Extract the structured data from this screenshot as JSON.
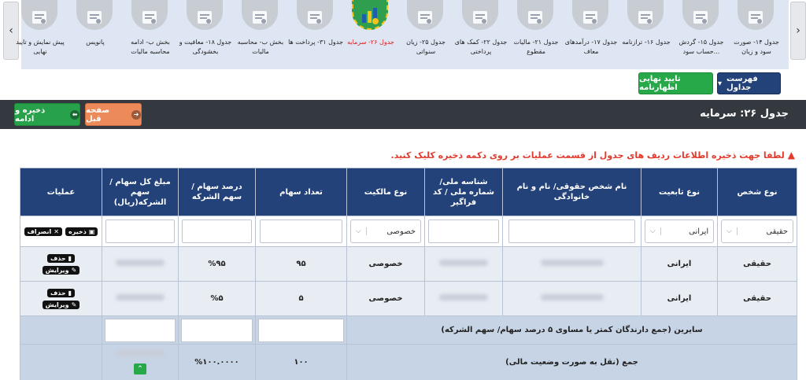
{
  "nav": {
    "items": [
      {
        "label": "جدول ۱۴- صورت سود و زیان",
        "icon": "scales-icon",
        "active": false
      },
      {
        "label": "جدول ۱۵- گردش حساب سود...",
        "icon": "coins-gear-icon",
        "active": false
      },
      {
        "label": "جدول ۱۶- ترازنامه",
        "icon": "calculator-icon",
        "active": false
      },
      {
        "label": "جدول ۱۷- درآمدهای معاف",
        "icon": "money-bag-icon",
        "active": false
      },
      {
        "label": "جدول ۲۱- مالیات مقطوع",
        "icon": "document-calculator-icon",
        "active": false
      },
      {
        "label": "جدول ۲۲- کمک های پرداختی",
        "icon": "certificate-icon",
        "active": false
      },
      {
        "label": "جدول ۲۵- زیان سنواتی",
        "icon": "loss-chart-icon",
        "active": false
      },
      {
        "label": "جدول ۲۶- سرمایه",
        "icon": "capital-icon",
        "active": true
      },
      {
        "label": "جدول ۳۱- پرداخت ها",
        "icon": "payment-icon",
        "active": false
      },
      {
        "label": "بخش ب- محاسبه مالیات",
        "icon": "tax-icon",
        "active": false
      },
      {
        "label": "جدول ۱۸- معافیت و بخشودگی",
        "icon": "monitor-icon",
        "active": false
      },
      {
        "label": "بخش ب- ادامه محاسبه مالیات",
        "icon": "tax-form-icon",
        "active": false
      },
      {
        "label": "پانویس",
        "icon": "user-document-icon",
        "active": false
      },
      {
        "label": "پیش نمایش و تایید نهایی",
        "icon": "stamp-icon",
        "active": false
      }
    ]
  },
  "buttons": {
    "final_approve": "تایید نهایی اظهارنامه",
    "table_list": "فهرست جداول",
    "prev_page": "صفحه قبل",
    "save_continue": "ذخیره و ادامه",
    "save": "ذخیره",
    "cancel": "انصراف",
    "delete": "حذف",
    "edit": "ویرایش"
  },
  "page": {
    "title": "جدول ۲۶: سرمایه",
    "warning": "لطفا جهت ذخیره اطلاعات ردیف های جدول از قسمت عملیات بر روی دکمه ذخیره کلیک کنید."
  },
  "table": {
    "headers": [
      "نوع شخص",
      "نوع تابعیت",
      "نام شخص حقوقی/ نام و نام خانوادگی",
      "شناسه ملی/ شماره ملی / کد فراگیر",
      "نوع مالکیت",
      "تعداد سهام",
      "درصد سهام / سهم الشرکه",
      "مبلغ کل سهام / سهم الشرکه(ریال)",
      "عملیات"
    ],
    "input_row": {
      "person_type": "حقیقی",
      "nationality": "ایرانی",
      "ownership": "خصوصی"
    },
    "rows": [
      {
        "person_type": "حقیقی",
        "nationality": "ایرانی",
        "ownership": "خصوصی",
        "shares": "۹۵",
        "percent": "%۹۵"
      },
      {
        "person_type": "حقیقی",
        "nationality": "ایرانی",
        "ownership": "خصوصی",
        "shares": "۵",
        "percent": "%۵"
      }
    ],
    "others_label": "سایرین (جمع دارندگان کمتر یا مساوی ۵ درصد سهام/ سهم الشرکه)",
    "total_label": "جمع (نقل به صورت وضعیت مالی)",
    "total_shares": "۱۰۰",
    "total_percent": "%۱۰۰.۰۰۰۰"
  },
  "colors": {
    "header_bg": "#34383f",
    "table_header": "#23427a",
    "green": "#27a94a",
    "orange": "#ed8a5a",
    "warning": "#e23b2e"
  }
}
